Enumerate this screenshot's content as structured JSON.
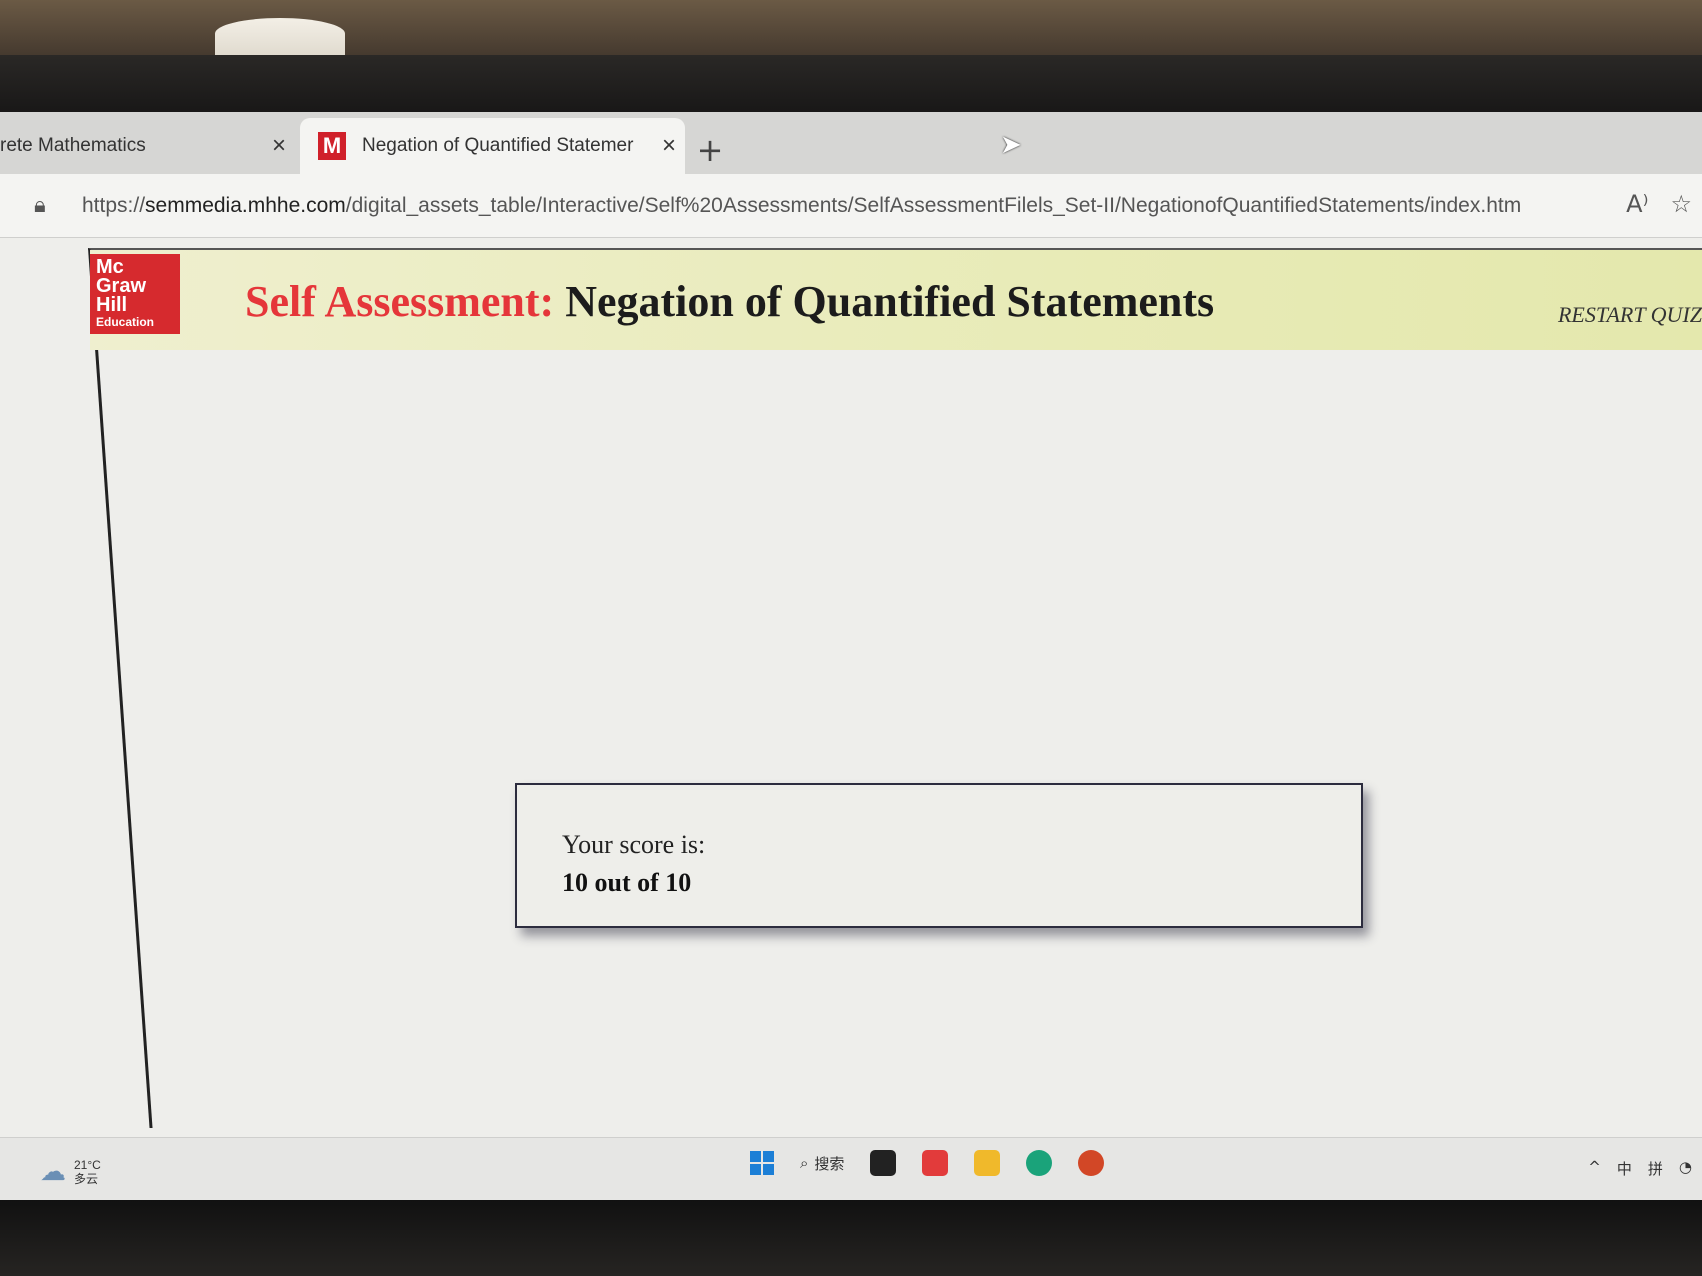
{
  "browser": {
    "tabs": [
      {
        "title": "rete Mathematics",
        "close": "×",
        "active": false
      },
      {
        "favicon": "M",
        "title": "Negation of Quantified Statemer",
        "close": "×",
        "active": true
      }
    ],
    "new_tab_label": "+",
    "url_prefix": "https://",
    "url_host": "semmedia.mhhe.com",
    "url_path": "/digital_assets_table/Interactive/Self%20Assessments/SelfAssessmentFilels_Set-II/NegationofQuantifiedStatements/index.html",
    "read_aloud_icon": "A⁾",
    "favorites_icon": "☆"
  },
  "page": {
    "logo": {
      "line1": "Mc",
      "line2": "Graw",
      "line3": "Hill",
      "line4": "Education"
    },
    "heading_prefix": "Self Assessment:",
    "heading_topic": "Negation of Quantified Statements",
    "restart_label": "RESTART QUIZ",
    "score": {
      "label": "Your score is:",
      "value": "10 out of 10"
    }
  },
  "taskbar": {
    "weather_temp": "21°C",
    "weather_desc": "多云",
    "search_label": "搜索",
    "tray_items": [
      "^",
      "中",
      "拼"
    ]
  },
  "colors": {
    "brand_red": "#d62a2e",
    "heading_red": "#e5363a",
    "banner_bg": "#e8ebb7"
  }
}
